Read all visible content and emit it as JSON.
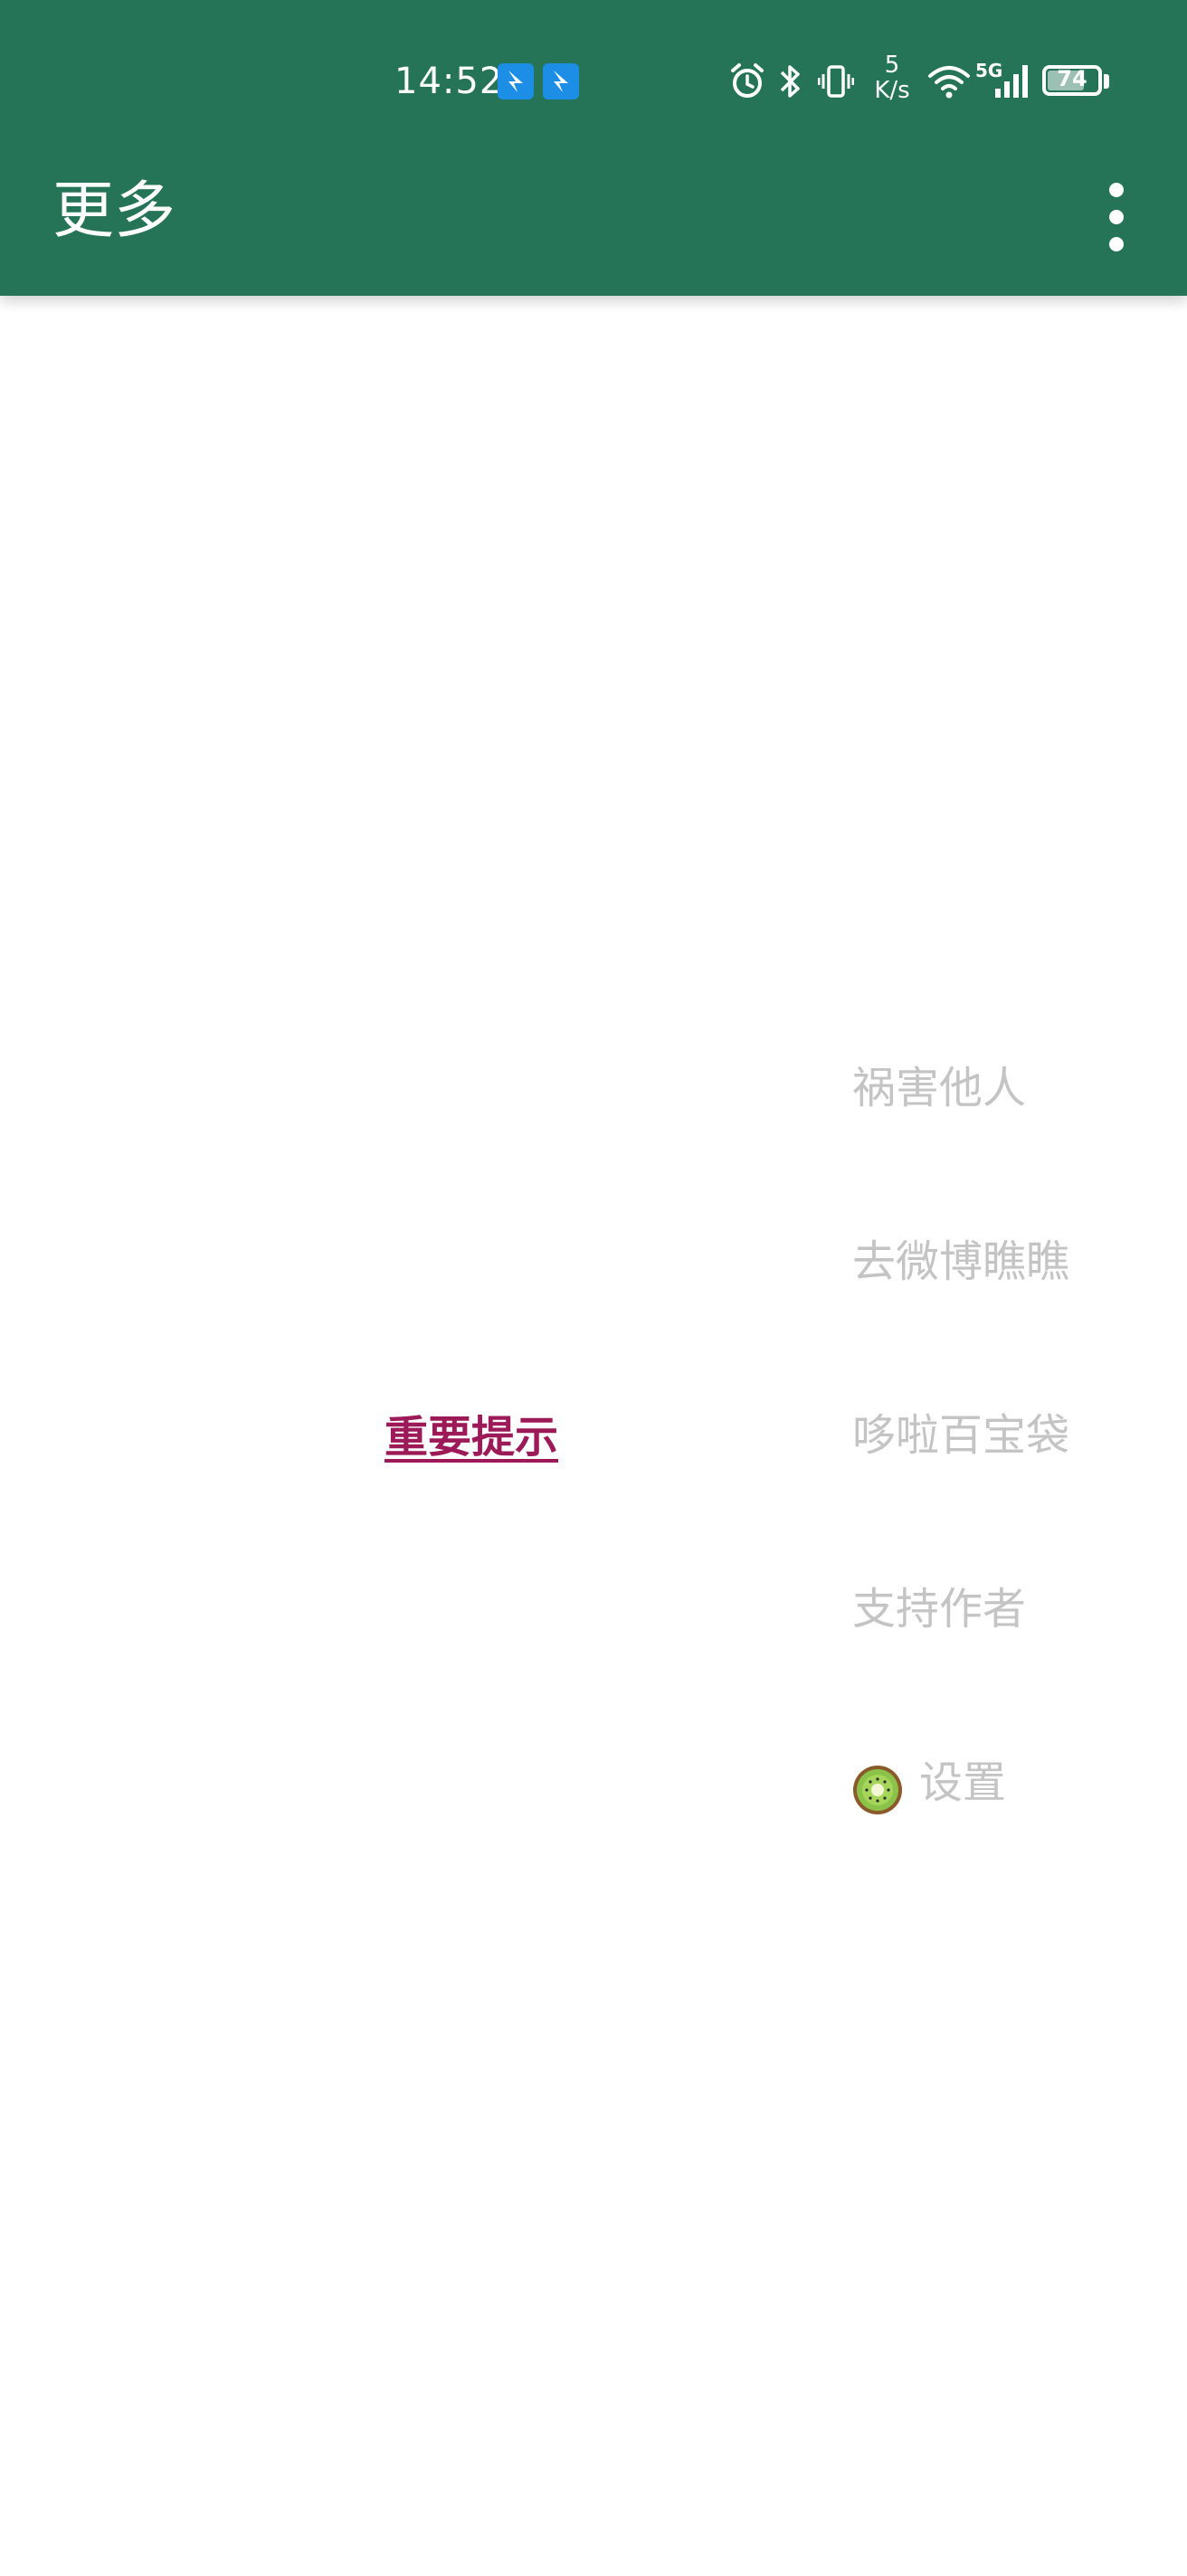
{
  "status_bar": {
    "time": "14:52",
    "net_speed_value": "5",
    "net_speed_unit": "K/s",
    "signal_type": "5G",
    "battery_level": "74",
    "battery_percent": 74
  },
  "app_bar": {
    "title": "更多",
    "overflow_icon": "more-vertical-icon"
  },
  "notice": {
    "label": "重要提示",
    "color": "#9b1a57"
  },
  "menu": {
    "items": [
      {
        "label": "祸害他人"
      },
      {
        "label": "去微博瞧瞧"
      },
      {
        "label": "哆啦百宝袋"
      },
      {
        "label": "支持作者"
      },
      {
        "label": "设置",
        "icon": "kiwi-icon"
      }
    ]
  },
  "colors": {
    "primary": "#257457",
    "menu_text": "#c4c4c4",
    "background": "#ffffff"
  }
}
